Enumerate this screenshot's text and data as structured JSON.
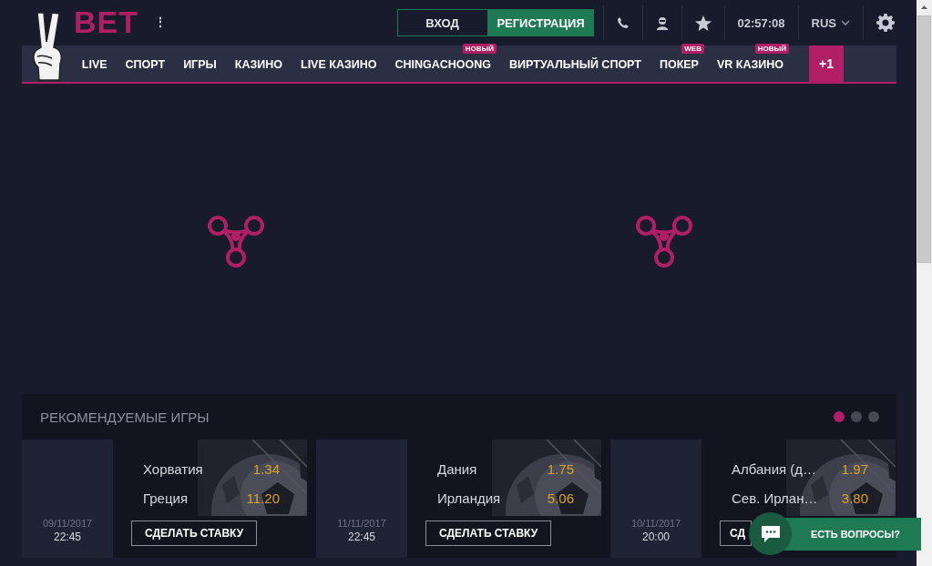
{
  "header": {
    "logo": "BET",
    "menu": "⋮",
    "login": "ВХОД",
    "register": "РЕГИСТРАЦИЯ",
    "time": "02:57:08",
    "language": "RUS"
  },
  "nav": [
    {
      "label": "LIVE"
    },
    {
      "label": "СПОРТ"
    },
    {
      "label": "ИГРЫ"
    },
    {
      "label": "КАЗИНО"
    },
    {
      "label": "LIVE КАЗИНО"
    },
    {
      "label": "CHINGACHOONG",
      "badge": "НОВЫЙ"
    },
    {
      "label": "ВИРТУАЛЬНЫЙ СПОРТ"
    },
    {
      "label": "ПОКЕР",
      "badge": "WEB"
    },
    {
      "label": "VR КАЗИНО",
      "badge": "НОВЫЙ"
    }
  ],
  "nav_more": "+1",
  "featured": {
    "title": "РЕКОМЕНДУЕМЫЕ ИГРЫ",
    "pages": [
      {
        "selected": true
      },
      {
        "selected": false
      },
      {
        "selected": false
      }
    ],
    "games": [
      {
        "date": "09/11/2017",
        "time": "22:45",
        "teams": [
          {
            "name": "Хорватия",
            "odds": "1.34"
          },
          {
            "name": "Греция",
            "odds": "11.20"
          }
        ],
        "button": "СДЕЛАТЬ СТАВКУ"
      },
      {
        "date": "11/11/2017",
        "time": "22:45",
        "teams": [
          {
            "name": "Дания",
            "odds": "1.75"
          },
          {
            "name": "Ирландия",
            "odds": "5.06"
          }
        ],
        "button": "СДЕЛАТЬ СТАВКУ"
      },
      {
        "date": "10/11/2017",
        "time": "20:00",
        "teams": [
          {
            "name": "Албания (д…",
            "odds": "1.97"
          },
          {
            "name": "Сев. Ирлан…",
            "odds": "3.80"
          }
        ],
        "button": "СД"
      }
    ]
  },
  "chat": {
    "label": "ЕСТЬ ВОПРОСЫ?"
  }
}
